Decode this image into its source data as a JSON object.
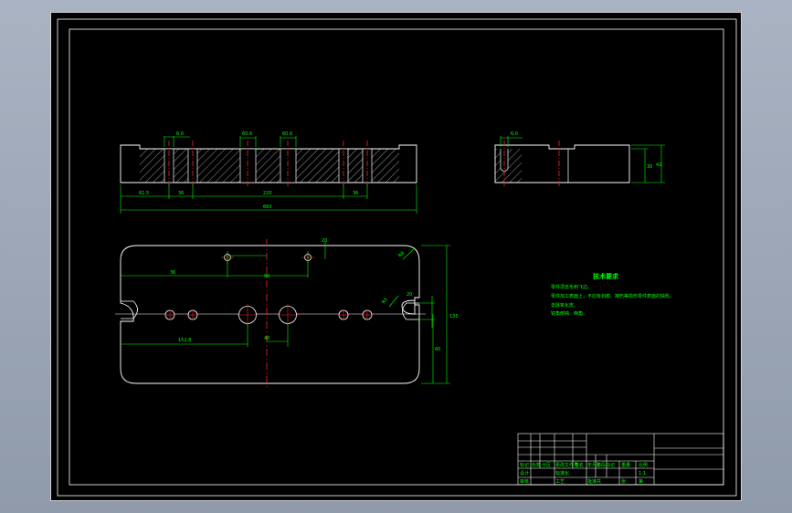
{
  "colors": {
    "outline": "#ffffff",
    "dimension": "#00ff00",
    "centerline": "#ff2020",
    "hatch": "#ffffff",
    "background": "#000000"
  },
  "front_view": {
    "dims": {
      "top_1": "6.0",
      "top_2": "60.6",
      "top_3": "60.6",
      "left_offset": "61.5",
      "pitch_1": "36",
      "middle": "220",
      "pitch_2": "36",
      "overall": "660"
    }
  },
  "side_view": {
    "dims": {
      "top": "6.0",
      "height_1": "30",
      "height_2": "42"
    }
  },
  "plan_view": {
    "dims": {
      "top_offset": "20",
      "upper_spacing": "90",
      "upper_left": "36",
      "slot_angle": "R8",
      "slot_r": "R5",
      "bottom_left": "152.8",
      "bottom_center": "40",
      "right_small": "20",
      "right_height_1": "60",
      "right_height_2": "135"
    }
  },
  "tech_requirements": {
    "title": "技术要求",
    "items": [
      "零件须去毛刺飞边。",
      "零件加工表面上，不应有划痕、擦伤等损伤零件表面的缺陷。",
      "去除氧化皮。",
      "锐角倒钝、倒角。"
    ]
  },
  "title_block": {
    "labels": {
      "r_biaoji": "标记",
      "r_chushu": "处数",
      "r_fenqu": "分区",
      "r_genggai": "更改文件号",
      "r_qianming": "签名",
      "r_riqi": "年月日",
      "r_sheji": "设计",
      "r_biaozhunhua": "标准化",
      "r_jieduan": "阶段标记",
      "r_zhongliang": "重量",
      "r_bili": "比例",
      "r_bili_val": "1:1",
      "r_shenhe": "审核",
      "r_gongyi": "工艺",
      "r_pizhun": "批准",
      "r_gong": "共",
      "r_zhang": "张",
      "r_di": "第"
    }
  }
}
